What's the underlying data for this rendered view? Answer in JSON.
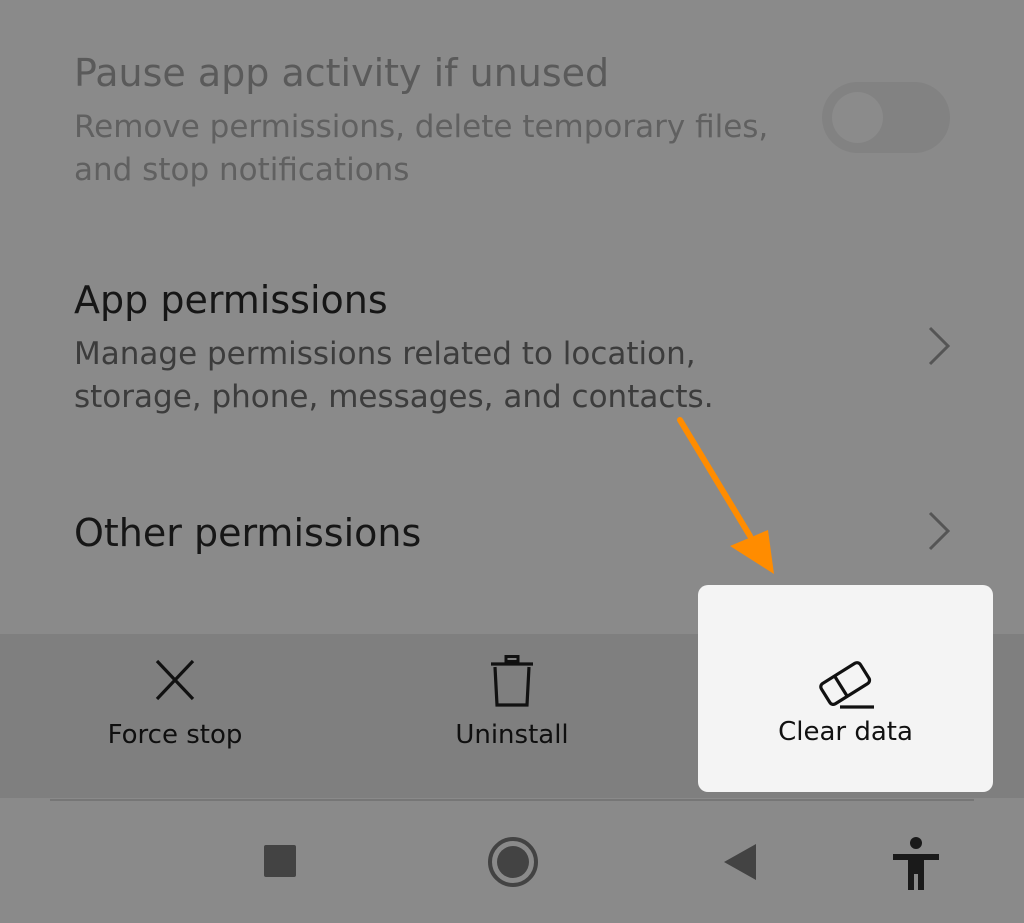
{
  "settings": {
    "pause": {
      "title": "Pause app activity if unused",
      "desc_line1": "Remove permissions, delete temporary files,",
      "desc_line2": "and stop notifications",
      "toggle_on": false
    },
    "app_permissions": {
      "title": "App permissions",
      "desc_line1": "Manage permissions related to location,",
      "desc_line2": "storage, phone, messages, and contacts."
    },
    "other_permissions": {
      "title": "Other permissions"
    }
  },
  "actions": {
    "force_stop": {
      "label": "Force stop",
      "icon": "close-icon"
    },
    "uninstall": {
      "label": "Uninstall",
      "icon": "trash-icon"
    },
    "clear_data": {
      "label": "Clear data",
      "icon": "eraser-icon"
    }
  },
  "nav": {
    "recents_icon": "square-recents-icon",
    "home_icon": "circle-home-icon",
    "back_icon": "triangle-back-icon",
    "accessibility_icon": "accessibility-person-icon"
  },
  "colors": {
    "overlay_dim": "#8a8a8a",
    "highlight_card": "#f4f4f4",
    "annotation_arrow": "#ff8c00"
  }
}
